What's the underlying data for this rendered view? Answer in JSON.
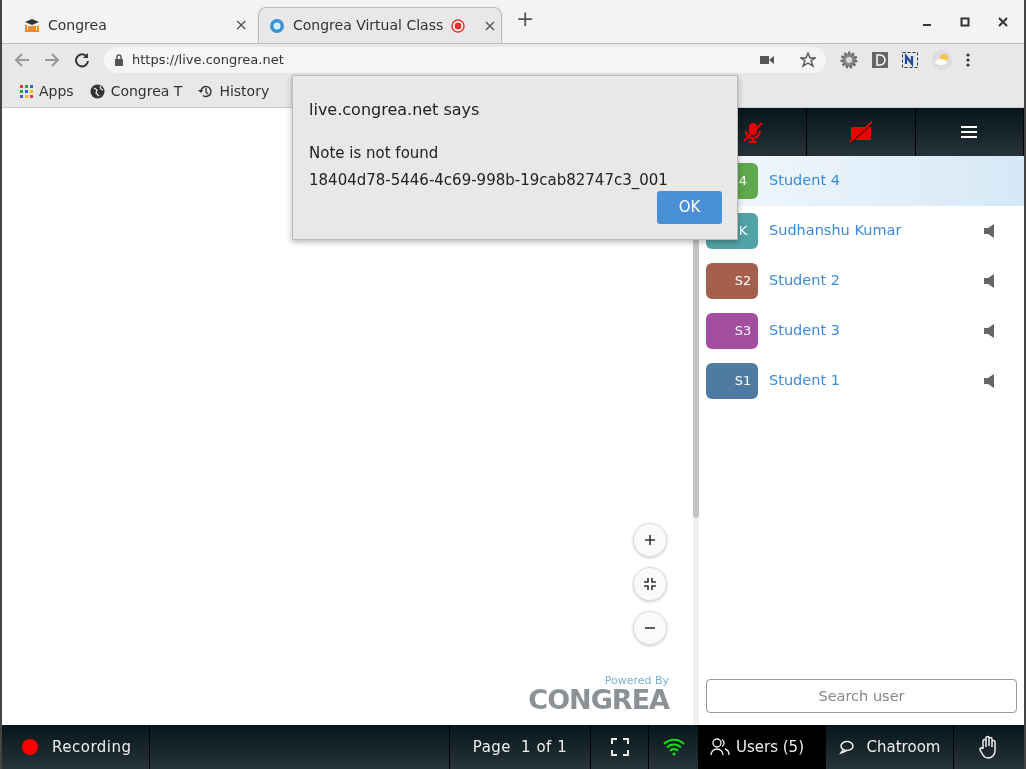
{
  "browser": {
    "tabs": [
      {
        "title": "Congrea",
        "selected": false,
        "recording": false,
        "close": "×"
      },
      {
        "title": "Congrea Virtual Class",
        "selected": true,
        "recording": true,
        "close": "×"
      }
    ],
    "new_tab": "+",
    "url": "https://live.congrea.net",
    "bookmarks": [
      {
        "label": "Apps",
        "kind": "apps"
      },
      {
        "label": "Congrea T",
        "kind": "globe"
      },
      {
        "label": "History",
        "kind": "history"
      }
    ]
  },
  "dialog": {
    "title": "live.congrea.net says",
    "lines": [
      "Note is not found",
      "18404d78-5446-4c69-998b-19cab82747c3_001"
    ],
    "button": "OK"
  },
  "whiteboard": {
    "zoom_buttons": [
      {
        "kind": "plus"
      },
      {
        "kind": "fit"
      },
      {
        "kind": "minus"
      }
    ],
    "powered_by": "Powered By",
    "brand": "CONGREA"
  },
  "users": [
    {
      "initials": "4",
      "name": "Student 4",
      "color": "#60a84e",
      "selected": true,
      "speaker": false
    },
    {
      "initials": "K",
      "name": "Sudhanshu Kumar",
      "color": "#52a3a6",
      "selected": false,
      "speaker": true
    },
    {
      "initials": "S2",
      "name": "Student 2",
      "color": "#a5604d",
      "selected": false,
      "speaker": true
    },
    {
      "initials": "S3",
      "name": "Student 3",
      "color": "#a44ea2",
      "selected": false,
      "speaker": true
    },
    {
      "initials": "S1",
      "name": "Student 1",
      "color": "#4f7ba3",
      "selected": false,
      "speaker": true
    }
  ],
  "search": {
    "placeholder": "Search user"
  },
  "footer": {
    "recording": "Recording",
    "page_label": "Page",
    "page_value": "1 of 1",
    "users": "Users (5)",
    "chatroom": "Chatroom"
  }
}
